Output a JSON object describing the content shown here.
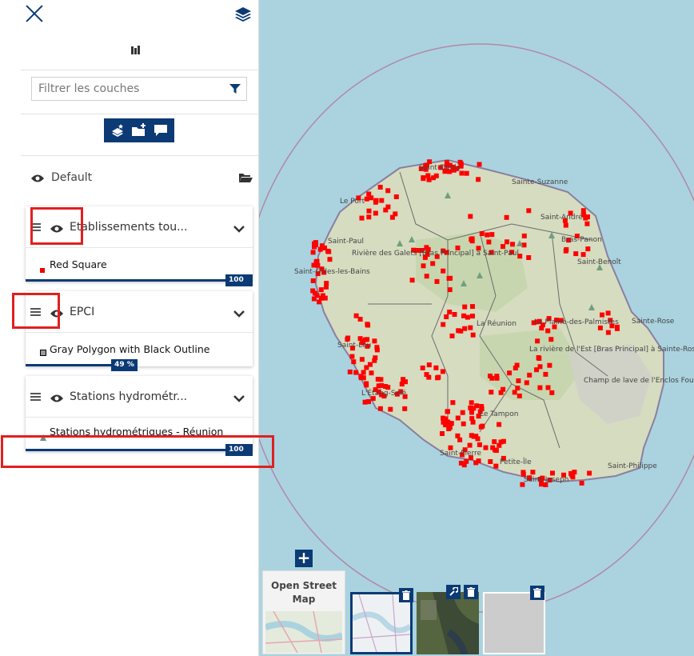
{
  "panel": {
    "filter_placeholder": "Filtrer les couches",
    "default_group": "Default"
  },
  "layers": [
    {
      "title": "Etablissements tou...",
      "legend": "Red Square",
      "opacity_label": "100 %",
      "opacity": 1.0
    },
    {
      "title": "EPCI",
      "legend": "Gray Polygon with Black Outline",
      "opacity_label": "49 %",
      "opacity": 0.49
    },
    {
      "title": "Stations hydrométr...",
      "legend": "Stations hydrométriques - Réunion",
      "opacity_label": "100 %",
      "opacity": 1.0
    }
  ],
  "basemaps": {
    "osm_label": "Open Street Map"
  },
  "map": {
    "places": [
      {
        "label": "Saint-Denis"
      },
      {
        "label": "Sainte-Suzanne"
      },
      {
        "label": "Le Port"
      },
      {
        "label": "Saint-André"
      },
      {
        "label": "Saint-Paul"
      },
      {
        "label": "Bras-Panon"
      },
      {
        "label": "Rivière des Galets [Bras Principal] à Saint-Paul"
      },
      {
        "label": "Saint-Benoît"
      },
      {
        "label": "Saint-Gilles-les-Bains"
      },
      {
        "label": "La Réunion"
      },
      {
        "label": "Sainte-Rose"
      },
      {
        "label": "La Plaine-des-Palmistes"
      },
      {
        "label": "La rivière de l'Est [Bras Principal] à Sainte-Rose"
      },
      {
        "label": "Saint-Leu"
      },
      {
        "label": "Champ de lave de l'Enclos Fouqué"
      },
      {
        "label": "L'Étang-Salé"
      },
      {
        "label": "Le Tampon"
      },
      {
        "label": "Saint-Pierre"
      },
      {
        "label": "Petite-Île"
      },
      {
        "label": "Saint-Philippe"
      },
      {
        "label": "Saint-Joseph"
      }
    ]
  },
  "colors": {
    "accent": "#0b3a75",
    "marker": "#ff0000",
    "annotation": "#e02020",
    "sea": "#aad3df",
    "land": "#d6dcc0"
  }
}
